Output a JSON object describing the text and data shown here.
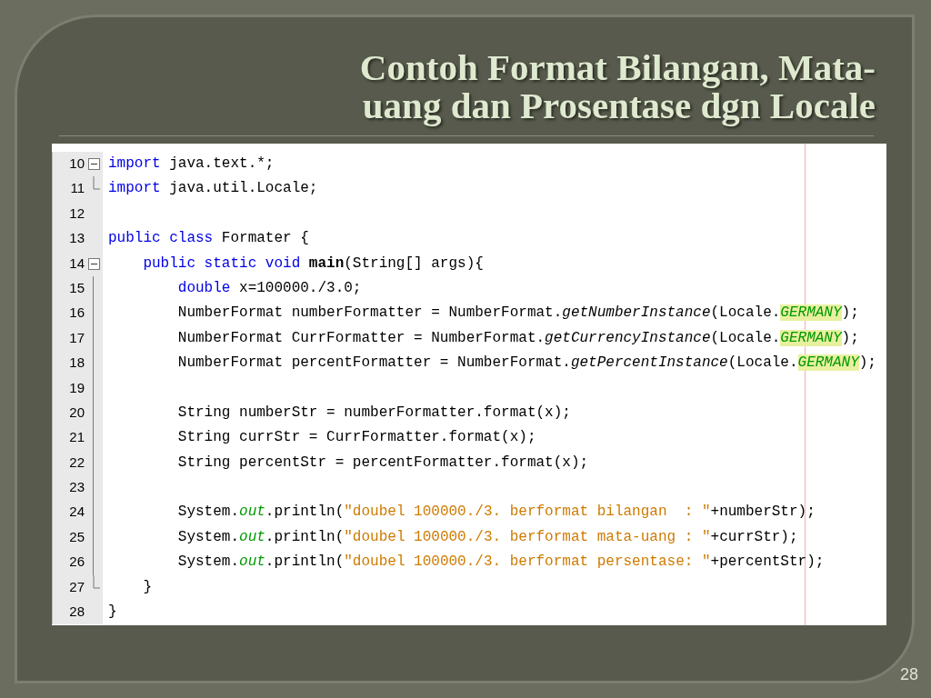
{
  "slide": {
    "title_lines": [
      "Contoh Format Bilangan, Mata-",
      "uang dan Prosentase dgn Locale"
    ],
    "page_number": "28"
  },
  "editor": {
    "lines": [
      {
        "number": "10",
        "kind": "fold_start",
        "tokens": [
          {
            "kind": "keyword",
            "text": "import"
          },
          {
            "kind": "plain",
            "text": " java.text.*;"
          }
        ]
      },
      {
        "number": "11",
        "kind": "fold_end",
        "tokens": [
          {
            "kind": "keyword",
            "text": "import"
          },
          {
            "kind": "plain",
            "text": " java.util.Locale;"
          }
        ]
      },
      {
        "number": "12",
        "kind": "plain"
      },
      {
        "number": "13",
        "kind": "plain",
        "tokens": [
          {
            "kind": "keyword",
            "text": "public class"
          },
          {
            "kind": "plain",
            "text": " Formater {"
          }
        ]
      },
      {
        "number": "14",
        "kind": "fold_start",
        "tokens": [
          {
            "kind": "keyword",
            "text": "    public static void "
          },
          {
            "kind": "method_decl",
            "text": "main"
          },
          {
            "kind": "plain",
            "text": "(String[] args){"
          }
        ]
      },
      {
        "number": "15",
        "kind": "fold_body",
        "tokens": [
          {
            "kind": "keyword",
            "text": "        double"
          },
          {
            "kind": "plain",
            "text": " x=100000./3.0;"
          }
        ]
      },
      {
        "number": "16",
        "kind": "fold_body",
        "tokens": [
          {
            "kind": "plain",
            "text": "        NumberFormat numberFormatter = NumberFormat."
          },
          {
            "kind": "static_method",
            "text": "getNumberInstance"
          },
          {
            "kind": "plain",
            "text": "(Locale."
          },
          {
            "kind": "constant",
            "text": "GERMANY"
          },
          {
            "kind": "plain",
            "text": ");"
          }
        ]
      },
      {
        "number": "17",
        "kind": "fold_body",
        "tokens": [
          {
            "kind": "plain",
            "text": "        NumberFormat CurrFormatter = NumberFormat."
          },
          {
            "kind": "static_method",
            "text": "getCurrencyInstance"
          },
          {
            "kind": "plain",
            "text": "(Locale."
          },
          {
            "kind": "constant",
            "text": "GERMANY"
          },
          {
            "kind": "plain",
            "text": ");"
          }
        ]
      },
      {
        "number": "18",
        "kind": "fold_body",
        "tokens": [
          {
            "kind": "plain",
            "text": "        NumberFormat percentFormatter = NumberFormat."
          },
          {
            "kind": "static_method",
            "text": "getPercentInstance"
          },
          {
            "kind": "plain",
            "text": "(Locale."
          },
          {
            "kind": "constant",
            "text": "GERMANY"
          },
          {
            "kind": "plain",
            "text": ");"
          }
        ]
      },
      {
        "number": "19",
        "kind": "fold_body"
      },
      {
        "number": "20",
        "kind": "fold_body",
        "tokens": [
          {
            "kind": "plain",
            "text": "        String numberStr = numberFormatter.format(x);"
          }
        ]
      },
      {
        "number": "21",
        "kind": "fold_body",
        "tokens": [
          {
            "kind": "plain",
            "text": "        String currStr = CurrFormatter.format(x);"
          }
        ]
      },
      {
        "number": "22",
        "kind": "fold_body",
        "tokens": [
          {
            "kind": "plain",
            "text": "        String percentStr = percentFormatter.format(x);"
          }
        ]
      },
      {
        "number": "23",
        "kind": "fold_body"
      },
      {
        "number": "24",
        "kind": "fold_body",
        "tokens": [
          {
            "kind": "plain",
            "text": "        System."
          },
          {
            "kind": "field",
            "text": "out"
          },
          {
            "kind": "plain",
            "text": ".println("
          },
          {
            "kind": "string",
            "text": "\"doubel 100000./3. berformat bilangan  : \""
          },
          {
            "kind": "plain",
            "text": "+numberStr);"
          }
        ]
      },
      {
        "number": "25",
        "kind": "fold_body",
        "tokens": [
          {
            "kind": "plain",
            "text": "        System."
          },
          {
            "kind": "field",
            "text": "out"
          },
          {
            "kind": "plain",
            "text": ".println("
          },
          {
            "kind": "string",
            "text": "\"doubel 100000./3. berformat mata-uang : \""
          },
          {
            "kind": "plain",
            "text": "+currStr);"
          }
        ]
      },
      {
        "number": "26",
        "kind": "fold_body",
        "tokens": [
          {
            "kind": "plain",
            "text": "        System."
          },
          {
            "kind": "field",
            "text": "out"
          },
          {
            "kind": "plain",
            "text": ".println("
          },
          {
            "kind": "string",
            "text": "\"doubel 100000./3. berformat persentase: \""
          },
          {
            "kind": "plain",
            "text": "+percentStr);"
          }
        ]
      },
      {
        "number": "27",
        "kind": "fold_end",
        "tokens": [
          {
            "kind": "plain",
            "text": "    }"
          }
        ]
      },
      {
        "number": "28",
        "kind": "plain",
        "tokens": [
          {
            "kind": "plain",
            "text": "}"
          }
        ]
      }
    ]
  }
}
